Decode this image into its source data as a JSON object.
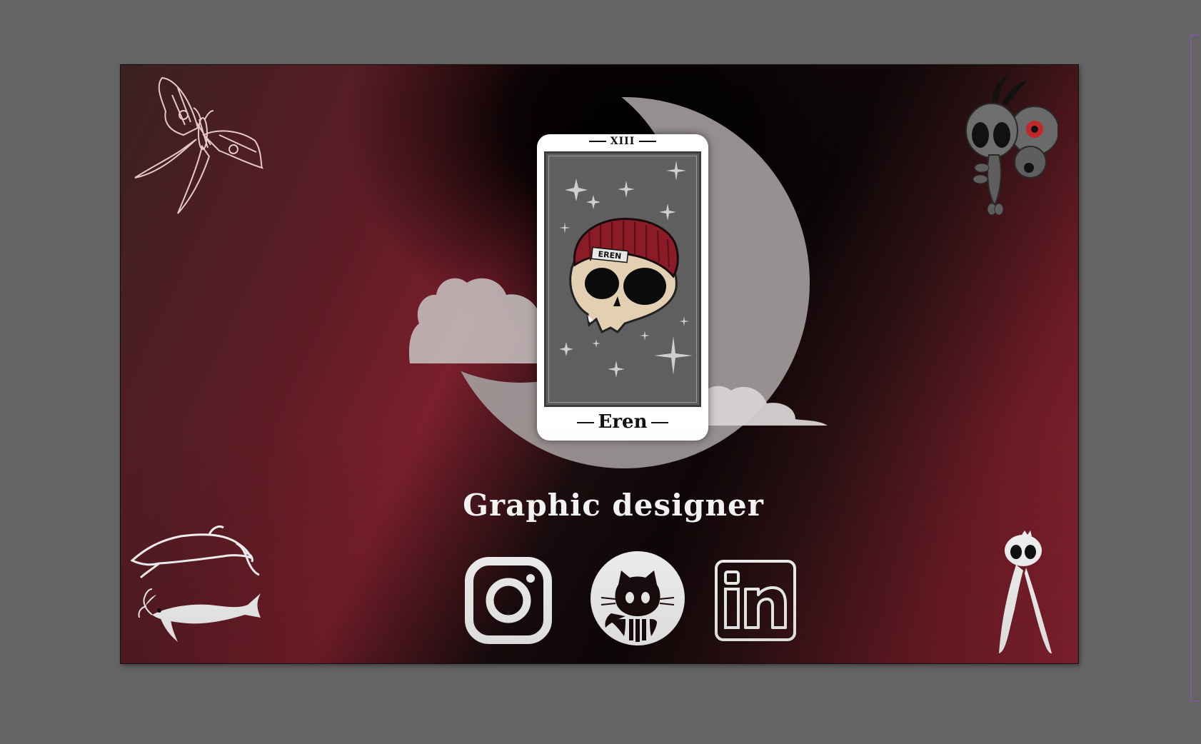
{
  "card": {
    "number": "XIII",
    "name": "Eren",
    "beanie_label": "EREN"
  },
  "tagline": "Graphic designer",
  "social": [
    {
      "name": "Instagram",
      "icon": "instagram-icon"
    },
    {
      "name": "GitHub",
      "icon": "github-icon"
    },
    {
      "name": "LinkedIn",
      "icon": "linkedin-icon"
    }
  ],
  "colors": {
    "workspace": "#646464",
    "card_background": "#ffffff",
    "card_frame": "#5f5f5f",
    "beanie": "#8a1c28",
    "skull": "#e3cfb2",
    "moon": "#a9a3a3",
    "accent_red": "#8c2331"
  }
}
